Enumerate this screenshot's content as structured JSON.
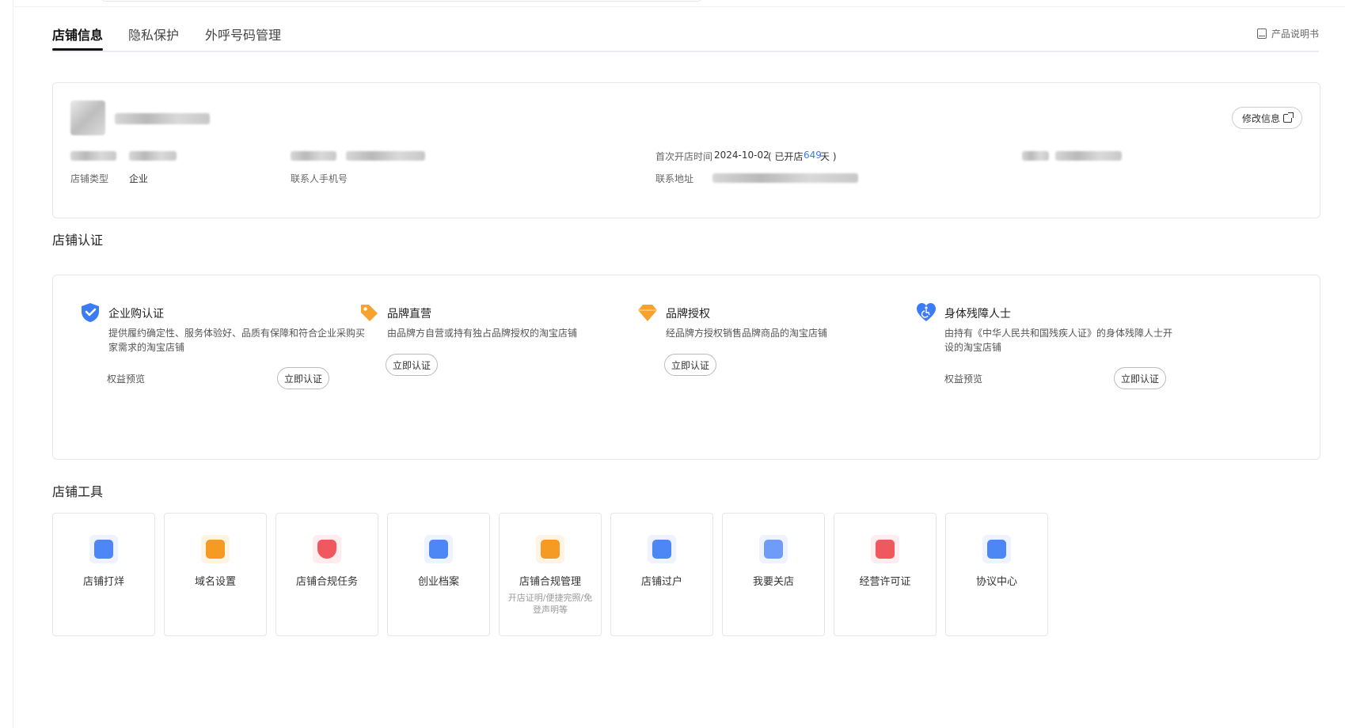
{
  "tabs": [
    {
      "label": "店铺信息",
      "active": true
    },
    {
      "label": "隐私保护",
      "active": false
    },
    {
      "label": "外呼号码管理",
      "active": false
    }
  ],
  "manual_link": "产品说明书",
  "store_info": {
    "edit_button": "修改信息",
    "store_type_label": "店铺类型",
    "store_type_value": "企业",
    "contact_phone_label": "联系人手机号",
    "first_open_label": "首次开店时间",
    "first_open_date": "2024-10-02",
    "opened_prefix": "( 已开店",
    "opened_days": "649",
    "opened_suffix": "天 )",
    "address_label": "联系地址"
  },
  "certification": {
    "section_title": "店铺认证",
    "items": [
      {
        "title": "企业购认证",
        "desc": "提供履约确定性、服务体验好、品质有保障和符合企业采购买家需求的淘宝店铺",
        "link": "权益预览",
        "button": "立即认证",
        "icon": "shield-check-icon",
        "color": "#3b7cf5"
      },
      {
        "title": "品牌直营",
        "desc": "由品牌方自营或持有独占品牌授权的淘宝店铺",
        "link": "",
        "button": "立即认证",
        "icon": "tag-icon",
        "color": "#f5a22e"
      },
      {
        "title": "品牌授权",
        "desc": "经品牌方授权销售品牌商品的淘宝店铺",
        "link": "",
        "button": "立即认证",
        "icon": "diamond-icon",
        "color": "#f5a22e"
      },
      {
        "title": "身体残障人士",
        "desc": "由持有《中华人民共和国残疾人证》的身体残障人士开设的淘宝店铺",
        "link": "权益预览",
        "button": "立即认证",
        "icon": "heart-accessibility-icon",
        "color": "#3b7cf5"
      }
    ]
  },
  "tools": {
    "section_title": "店铺工具",
    "items": [
      {
        "label": "店铺打烊",
        "sub": "",
        "icon": "store-close-icon",
        "color": "#4d86f5",
        "bg": "#eaf1ff"
      },
      {
        "label": "域名设置",
        "sub": "",
        "icon": "domain-icon",
        "color": "#f59a23",
        "bg": "#fff3e4"
      },
      {
        "label": "店铺合规任务",
        "sub": "",
        "icon": "compliance-shield-icon",
        "color": "#f0585f",
        "bg": "#ffecee"
      },
      {
        "label": "创业档案",
        "sub": "",
        "icon": "archive-icon",
        "color": "#4d86f5",
        "bg": "#eaf1ff"
      },
      {
        "label": "店铺合规管理",
        "sub": "开店证明/便捷完照/免登声明等",
        "icon": "document-manage-icon",
        "color": "#f59a23",
        "bg": "#fff3e4"
      },
      {
        "label": "店铺过户",
        "sub": "",
        "icon": "transfer-icon",
        "color": "#4d86f5",
        "bg": "#eaf1ff"
      },
      {
        "label": "我要关店",
        "sub": "",
        "icon": "close-store-icon",
        "color": "#6f9cf7",
        "bg": "#eaf1ff"
      },
      {
        "label": "经营许可证",
        "sub": "",
        "icon": "license-icon",
        "color": "#f0585f",
        "bg": "#ffecee"
      },
      {
        "label": "协议中心",
        "sub": "",
        "icon": "agreement-icon",
        "color": "#4d86f5",
        "bg": "#eaf1ff"
      }
    ]
  }
}
